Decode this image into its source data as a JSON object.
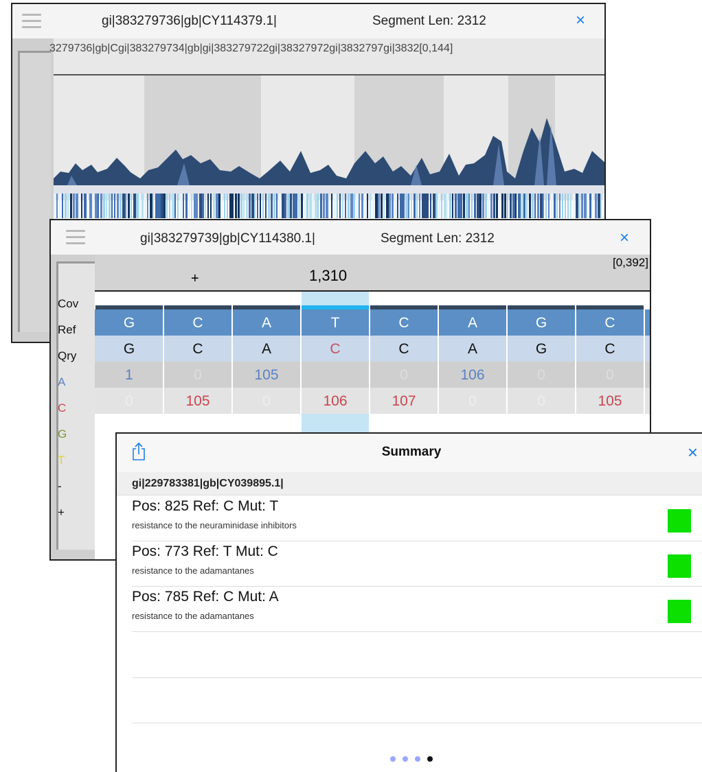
{
  "panel1": {
    "header_id": "gi|383279736|gb|CY114379.1|",
    "segment_len": "Segment Len: 2312",
    "close": "×",
    "segment_labels": "3279736|gb|Cgi|383279734|gb|gi|383279722gi|38327972gi|3832797gi|3832[0,144]"
  },
  "panel2": {
    "header_id": "gi|383279739|gb|CY114380.1|",
    "segment_len": "Segment Len: 2312",
    "close": "×",
    "ruler_plus": "+",
    "ruler_position": "1,310",
    "ruler_range": "[0,392]",
    "row_labels": [
      "Cov",
      "Ref",
      "Qry",
      "A",
      "C",
      "G",
      "T",
      "-",
      "+"
    ],
    "ref": [
      "G",
      "C",
      "A",
      "T",
      "C",
      "A",
      "G",
      "C"
    ],
    "qry": [
      "G",
      "C",
      "A",
      "C",
      "C",
      "A",
      "G",
      "C"
    ],
    "a_counts": [
      "1",
      "0",
      "105",
      "",
      "0",
      "106",
      "0",
      "0"
    ],
    "c_counts": [
      "0",
      "105",
      "0",
      "106",
      "107",
      "0",
      "0",
      "105"
    ],
    "g_partial": "1"
  },
  "summary": {
    "title": "Summary",
    "close": "×",
    "gi": "gi|229783381|gb|CY039895.1|",
    "mutations": [
      {
        "title": "Pos: 825 Ref: C Mut: T",
        "desc": "resistance to the neuraminidase inhibitors"
      },
      {
        "title": "Pos: 773 Ref: T Mut: C",
        "desc": "resistance to the adamantanes"
      },
      {
        "title": "Pos: 785 Ref: C Mut: A",
        "desc": "resistance to the adamantanes"
      }
    ],
    "page_count": 4,
    "active_page": 4
  }
}
